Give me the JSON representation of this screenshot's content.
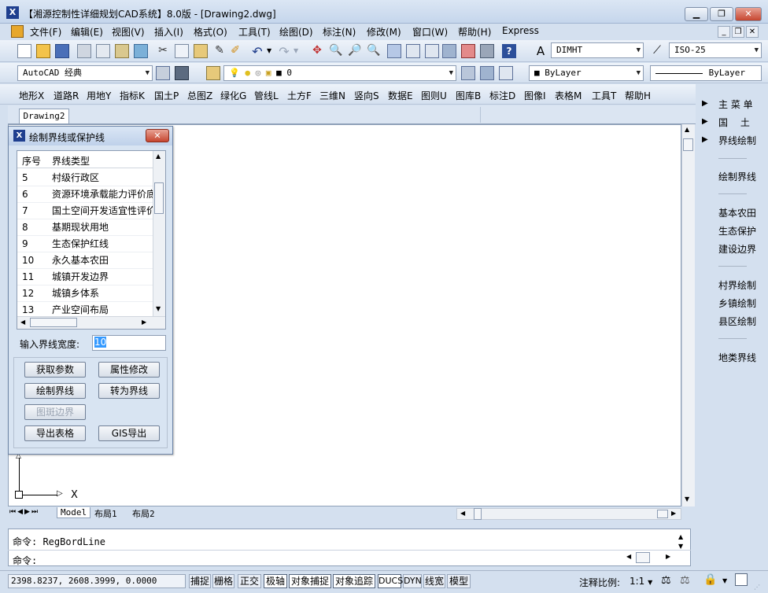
{
  "window": {
    "title": "【湘源控制性详细规划CAD系统】8.0版 - [Drawing2.dwg]",
    "app_icon": "X",
    "minimize_icon": "minimize-icon",
    "maximize_icon": "maximize-icon",
    "close_icon": "close-icon"
  },
  "menubar": {
    "items": [
      "文件(F)",
      "编辑(E)",
      "视图(V)",
      "插入(I)",
      "格式(O)",
      "工具(T)",
      "绘图(D)",
      "标注(N)",
      "修改(M)",
      "窗口(W)",
      "帮助(H)",
      "Express"
    ]
  },
  "toolbar2": {
    "dimstyle": "DIMHT",
    "textstyle": "ISO-25"
  },
  "toolbar3": {
    "workspace": "AutoCAD 经典",
    "layer": "0",
    "color": "ByLayer",
    "linetype": "ByLayer"
  },
  "toolbar4": {
    "items": [
      "地形X",
      "道路R",
      "用地Y",
      "指标K",
      "国土P",
      "总图Z",
      "绿化G",
      "管线L",
      "土方F",
      "三维N",
      "竖向S",
      "数据E",
      "图则U",
      "图库B",
      "标注D",
      "图像I",
      "表格M",
      "工具T",
      "帮助H"
    ]
  },
  "drawing_tab": "Drawing2",
  "right_panel": {
    "items": [
      "主 菜 单",
      "国　 土",
      "界线绘制",
      "绘制界线",
      "基本农田",
      "生态保护",
      "建设边界",
      "村界绘制",
      "乡镇绘制",
      "县区绘制",
      "地类界线"
    ],
    "separator": "———"
  },
  "dialog": {
    "title": "绘制界线或保护线",
    "columns": [
      "序号",
      "界线类型"
    ],
    "rows": [
      {
        "no": "5",
        "type": "村级行政区"
      },
      {
        "no": "6",
        "type": "资源环境承载能力评价底线"
      },
      {
        "no": "7",
        "type": "国土空间开发适宜性评价底线"
      },
      {
        "no": "8",
        "type": "基期现状用地"
      },
      {
        "no": "9",
        "type": "生态保护红线"
      },
      {
        "no": "10",
        "type": "永久基本农田"
      },
      {
        "no": "11",
        "type": "城镇开发边界"
      },
      {
        "no": "12",
        "type": "城镇乡体系"
      },
      {
        "no": "13",
        "type": "产业空间布局"
      }
    ],
    "width_label": "输入界线宽度:",
    "width_value": "10",
    "buttons": {
      "get_params": "获取参数",
      "modify_attr": "属性修改",
      "draw_line": "绘制界线",
      "convert_line": "转为界线",
      "patch_border": "图斑边界",
      "export_table": "导出表格",
      "gis_export": "GIS导出"
    }
  },
  "ucs": {
    "x_label": "X"
  },
  "layout_tabs": [
    "Model",
    "布局1",
    "布局2"
  ],
  "command": {
    "history": "命令: RegBordLine",
    "prompt": "命令:"
  },
  "statusbar": {
    "coords": "2398.8237, 2608.3999, 0.0000",
    "toggles": [
      "捕捉",
      "栅格",
      "正交",
      "极轴",
      "对象捕捉",
      "对象追踪",
      "DUCS",
      "DYN",
      "线宽",
      "模型"
    ],
    "annotation_scale_label": "注释比例:",
    "annotation_scale": "1:1"
  },
  "colors": {
    "chrome": "#d4e0ef",
    "canvas": "#ffffff",
    "selected_text": "#3399ff"
  }
}
